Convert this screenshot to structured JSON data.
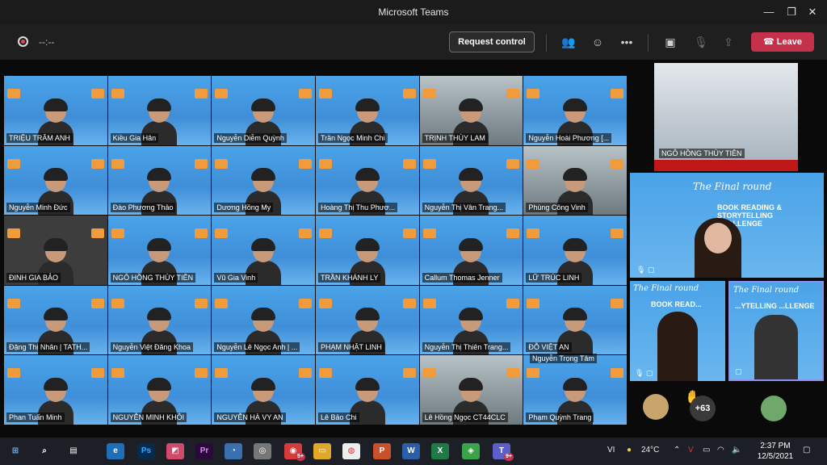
{
  "window": {
    "title": "Microsoft Teams"
  },
  "toolbar": {
    "timer": "--:--",
    "request_control": "Request control",
    "leave": "Leave"
  },
  "grid": {
    "participants": [
      "TRIỆU TRÂM ANH",
      "Kiều Gia Hân",
      "Nguyễn Diễm Quỳnh",
      "Trần Ngọc Minh Chi",
      "TRỊNH THÙY LAM",
      "Nguyễn Hoài Phương [...",
      "Nguyễn Minh Đức",
      "Đào Phương Thảo",
      "Dương Hồng My",
      "Hoàng Thị Thu Phươ...",
      "Nguyễn Thị Vân Trang...",
      "Phùng Công Vinh",
      "ĐINH GIA BẢO",
      "NGÔ HỒNG THÙY TIÊN",
      "Vũ Gia Vinh",
      "TRẦN KHÁNH LY",
      "Callum Thomas Jenner",
      "LỮ TRÚC LINH",
      "Đặng Thị Nhân | TATH...",
      "Nguyễn Việt Đăng Khoa",
      "Nguyễn Lê Ngọc Anh | ...",
      "PHẠM NHẬT LINH",
      "Nguyễn Thị Thiên Trang...",
      "ĐỖ VIỆT AN",
      "Phan Tuấn Minh",
      "NGUYỄN MINH KHÔI",
      "NGUYỄN HÀ VY AN",
      "Lê Bảo Chi",
      "Lê Hồng Ngọc CT44CLC",
      "Phạm Quỳnh Trang"
    ],
    "extra": "Nguyễn Trọng Tâm"
  },
  "sidebar": {
    "featured_name": "NGÔ HỒNG THÙY TIÊN",
    "big_title": "The Final round",
    "big_sub": "BOOK READING & STORYTELLING CHALLENGE",
    "small_title": "The Final round",
    "small_sub_left": "BOOK READ...",
    "small_sub_right": "...YTELLING ...LLENGE",
    "overflow_count": "+63"
  },
  "taskbar": {
    "weather": "24°C",
    "lang": "VI",
    "time": "2:37 PM",
    "date": "12/5/2021"
  },
  "colors": {
    "leave": "#c4314b",
    "tile_bg": "#4aa3e8",
    "teams": "#5b5fc7"
  }
}
